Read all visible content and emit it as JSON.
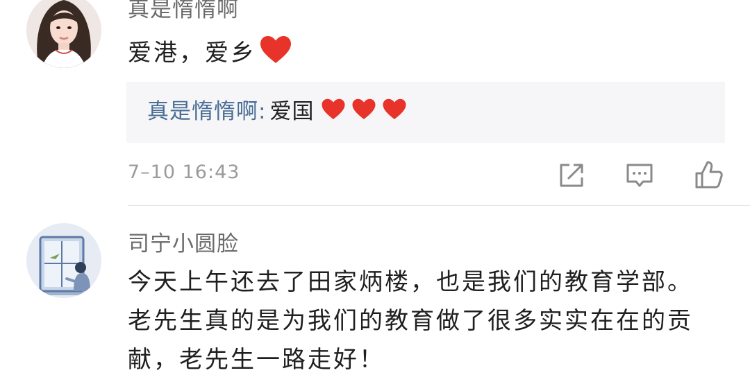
{
  "comments": [
    {
      "username": "真是惰惰啊",
      "text": "爱港，爱乡",
      "reply": {
        "username": "真是惰惰啊",
        "separator": ":",
        "text": "爱国"
      },
      "timestamp": "7–10 16:43",
      "actions": [
        "share-icon",
        "comment-icon",
        "like-icon"
      ]
    },
    {
      "username": "司宁小圆脸",
      "text_lines": [
        "今天上午还去了田家炳楼，也是我们的教育学部。",
        "老先生真的是为我们的教育做了很多实实在在的贡",
        "献，老先生一路走好！"
      ]
    }
  ],
  "colors": {
    "heart": "#e8332a",
    "reply_user": "#4a6d95",
    "reply_bg": "#f6f6f8",
    "muted": "#9a9a9a"
  }
}
